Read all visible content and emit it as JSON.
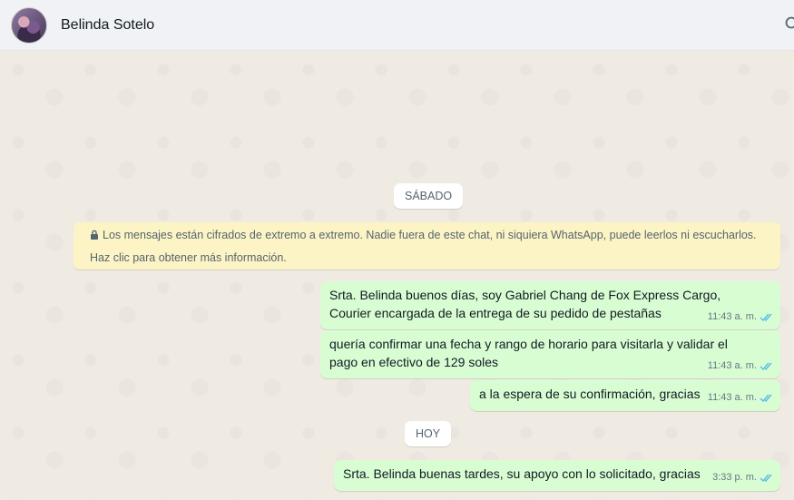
{
  "header": {
    "contact_name": "Belinda Sotelo"
  },
  "chat": {
    "date_separators": [
      "SÁBADO",
      "HOY"
    ],
    "encryption_notice": "Los mensajes están cifrados de extremo a extremo. Nadie fuera de este chat, ni siquiera WhatsApp, puede leerlos ni escucharlos. Haz clic para obtener más información.",
    "messages": [
      {
        "text": "Srta. Belinda buenos días, soy Gabriel Chang de Fox Express Cargo, Courier encargada de la entrega de su pedido de pestañas",
        "time": "11:43 a. m.",
        "status": "read"
      },
      {
        "text": "quería confirmar una fecha y rango de horario para visitarla y validar el pago en efectivo de 129 soles",
        "time": "11:43 a. m.",
        "status": "read"
      },
      {
        "text": "a la espera de su confirmación, gracias",
        "time": "11:43 a. m.",
        "status": "read"
      },
      {
        "text": "Srta. Belinda buenas tardes, su apoyo con lo solicitado, gracias",
        "time": "3:33 p. m.",
        "status": "read"
      }
    ]
  },
  "colors": {
    "outgoing_bubble": "#d9fdd3",
    "notice_bg": "#fdf4c5",
    "read_check": "#53bdeb",
    "chat_bg": "#efeae2"
  },
  "icons": {
    "lock": "lock-icon",
    "read_receipt": "double-check-icon",
    "search": "search-icon"
  }
}
